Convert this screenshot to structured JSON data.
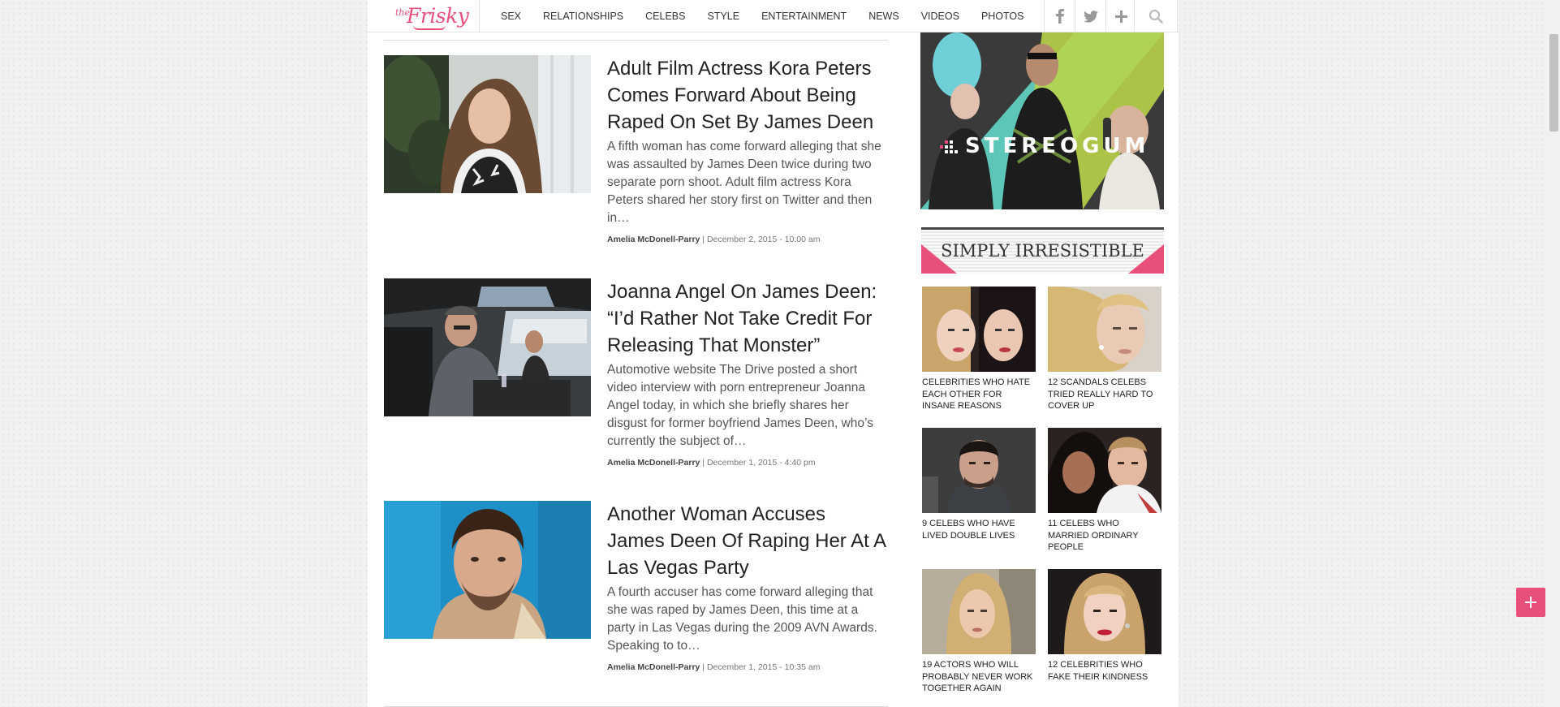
{
  "brand": {
    "logo_small": "the",
    "logo_name": "Frisky",
    "accent": "#e8507b"
  },
  "nav": {
    "items": [
      {
        "label": "SEX"
      },
      {
        "label": "RELATIONSHIPS"
      },
      {
        "label": "CELEBS"
      },
      {
        "label": "STYLE"
      },
      {
        "label": "ENTERTAINMENT"
      },
      {
        "label": "NEWS"
      },
      {
        "label": "VIDEOS"
      },
      {
        "label": "PHOTOS"
      }
    ],
    "social_icons": [
      "facebook-icon",
      "twitter-icon",
      "plus-icon"
    ],
    "search_icon": "search-icon"
  },
  "articles": [
    {
      "title": "Adult Film Actress Kora Peters Comes Forward About Being Raped On Set By James Deen",
      "excerpt": "A fifth woman has come forward alleging that she was assaulted by James Deen twice during two separate porn shoot. Adult film actress Kora Peters shared her story first on Twitter and then in…",
      "author": "Amelia McDonell-Parry",
      "date": "| December 2, 2015 - 10:00 am"
    },
    {
      "title": "Joanna Angel On James Deen: “I’d Rather Not Take Credit For Releasing That Monster”",
      "excerpt": "Automotive website The Drive posted a short video interview with porn entrepreneur Joanna Angel today, in which she briefly shares her disgust for former boyfriend James Deen, who’s currently the subject of…",
      "author": "Amelia McDonell-Parry",
      "date": "| December 1, 2015 - 4:40 pm"
    },
    {
      "title": "Another Woman Accuses James Deen Of Raping Her At A Las Vegas Party",
      "excerpt": "A fourth accuser has come forward alleging that she was raped by James Deen, this time at a party in Las Vegas during the 2009 AVN Awards. Speaking to to…",
      "author": "Amelia McDonell-Parry",
      "date": "| December 1, 2015 - 10:35 am"
    }
  ],
  "sidebar": {
    "ad_brand": "STEREOGUM",
    "section_title": "SIMPLY IRRESISTIBLE",
    "tiles": [
      {
        "caption": "CELEBRITIES WHO HATE EACH OTHER FOR INSANE REASONS"
      },
      {
        "caption": "12 SCANDALS CELEBS TRIED REALLY HARD TO COVER UP"
      },
      {
        "caption": "9 CELEBS WHO HAVE LIVED DOUBLE LIVES"
      },
      {
        "caption": "11 CELEBS WHO MARRIED ORDINARY PEOPLE"
      },
      {
        "caption": "19 ACTORS WHO WILL PROBABLY NEVER WORK TOGETHER AGAIN"
      },
      {
        "caption": "12 CELEBRITIES WHO FAKE THEIR KINDNESS"
      }
    ]
  },
  "fab_icon": "plus-icon"
}
